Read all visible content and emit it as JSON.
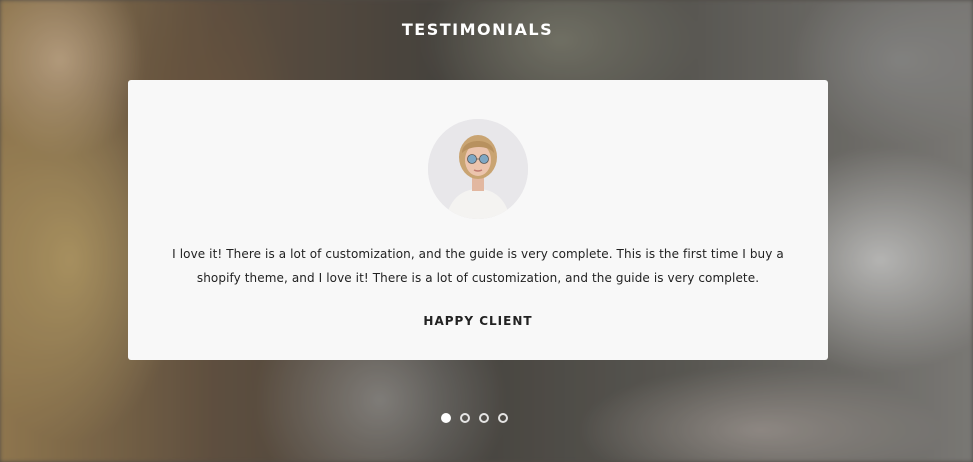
{
  "section": {
    "title": "TESTIMONIALS"
  },
  "testimonial": {
    "quote": "I love it! There is a lot of customization, and the guide is very complete. This is the first time I buy a shopify theme, and I love it! There is a lot of customization, and the guide is very complete.",
    "author": "HAPPY CLIENT"
  },
  "pagination": {
    "total": 4,
    "active_index": 0
  },
  "colors": {
    "card_background": "#f8f8f8",
    "title_text": "#ffffff",
    "body_text": "#222222",
    "dot_active": "#ffffff"
  }
}
